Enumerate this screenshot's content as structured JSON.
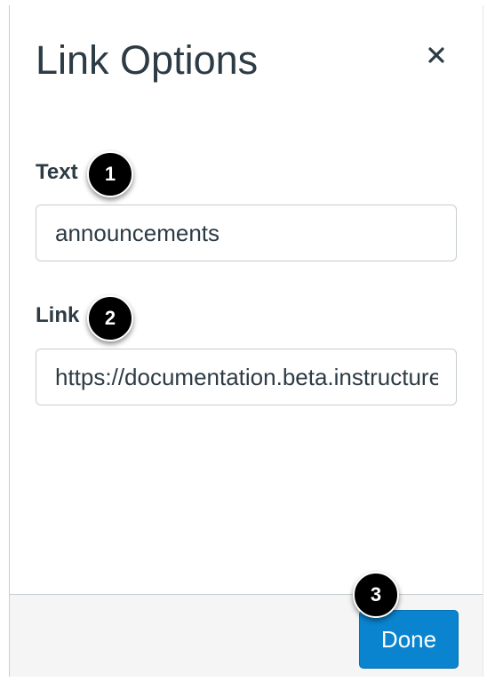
{
  "dialog": {
    "title": "Link Options",
    "close_icon": "close-icon"
  },
  "fields": {
    "text_label": "Text",
    "text_value": "announcements",
    "link_label": "Link",
    "link_value": "https://documentation.beta.instructure.com"
  },
  "footer": {
    "done_label": "Done"
  },
  "callouts": [
    "1",
    "2",
    "3"
  ],
  "colors": {
    "accent": "#0a84cf",
    "text": "#2d3b45",
    "border": "#c7cdd1",
    "footer_bg": "#f5f5f5",
    "callout_bg": "#000000"
  }
}
